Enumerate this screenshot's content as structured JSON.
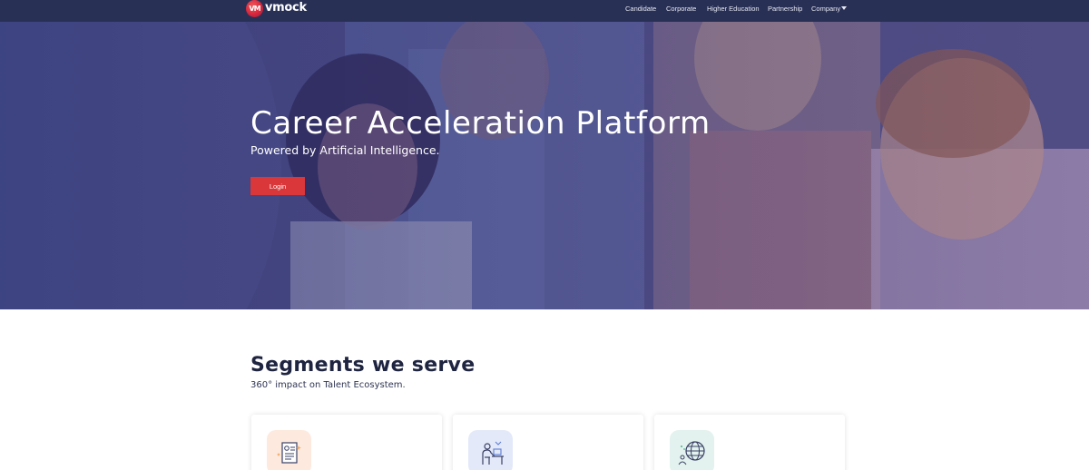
{
  "brand": {
    "name": "vmock",
    "mark": "VM"
  },
  "nav": {
    "items": [
      {
        "label": "Candidate"
      },
      {
        "label": "Corporate"
      },
      {
        "label": "Higher Education"
      },
      {
        "label": "Partnership"
      },
      {
        "label": "Company",
        "has_dropdown": true
      }
    ]
  },
  "hero": {
    "title": "Career Acceleration Platform",
    "subtitle": "Powered by Artificial Intelligence.",
    "login_label": "Login"
  },
  "segments": {
    "title": "Segments we serve",
    "subtitle": "360° impact on Talent Ecosystem.",
    "cards": [
      {
        "icon": "resume-document-icon",
        "icon_bg": "#fde9de"
      },
      {
        "icon": "person-at-desk-icon",
        "icon_bg": "#e3e9f8"
      },
      {
        "icon": "globe-network-icon",
        "icon_bg": "#e3f2ee"
      }
    ]
  },
  "colors": {
    "nav_bg": "#283056",
    "accent": "#d9373a",
    "heading": "#1f2540"
  }
}
